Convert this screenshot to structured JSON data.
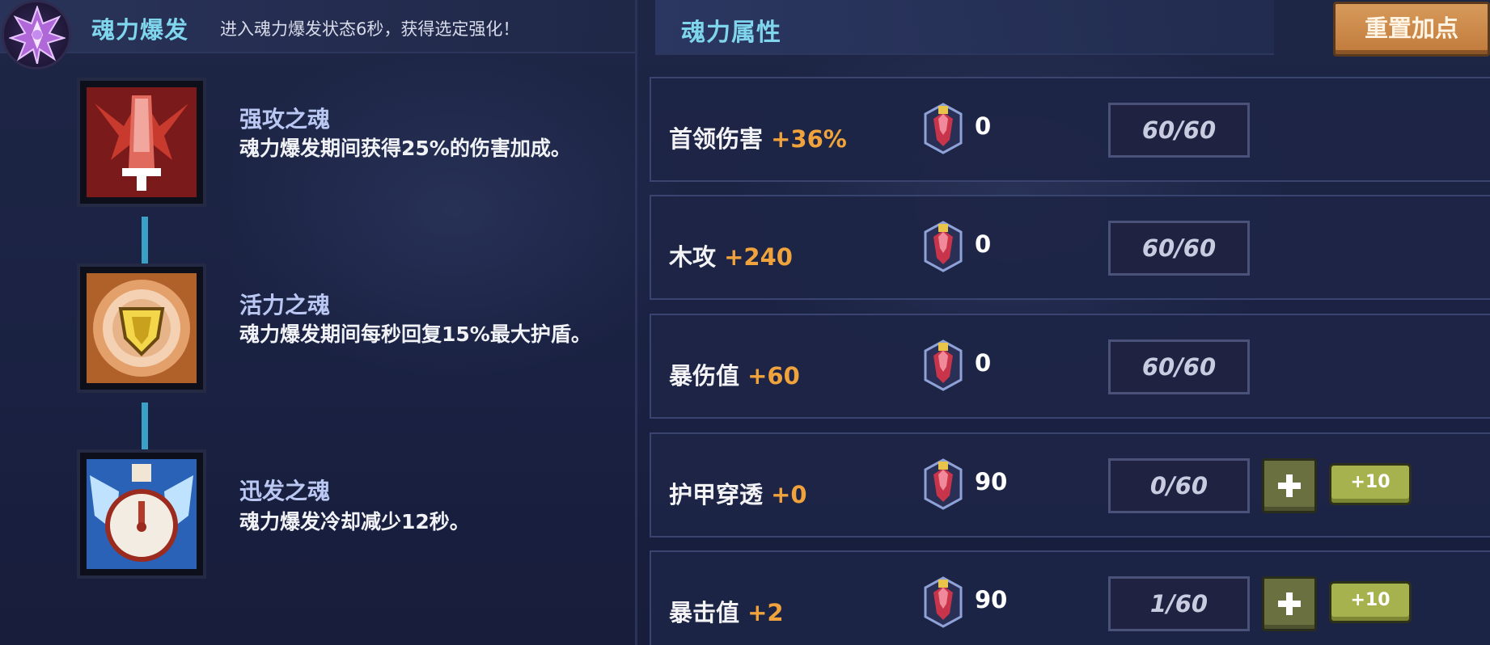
{
  "burst": {
    "title": "魂力爆发",
    "description": "进入魂力爆发状态6秒，获得选定强化！"
  },
  "souls": [
    {
      "name": "强攻之魂",
      "description": "魂力爆发期间获得25%的伤害加成。",
      "icon": "fire-armor-icon"
    },
    {
      "name": "活力之魂",
      "description": "魂力爆发期间每秒回复15%最大护盾。",
      "icon": "golden-shield-icon"
    },
    {
      "name": "迅发之魂",
      "description": "魂力爆发冷却减少12秒。",
      "icon": "winged-clock-icon"
    }
  ],
  "attributes": {
    "title": "魂力属性",
    "reset_label": "重置加点",
    "rows": [
      {
        "name": "首领伤害",
        "bonus": "+36%",
        "cost": "0",
        "progress": "60/60"
      },
      {
        "name": "木攻",
        "bonus": "+240",
        "cost": "0",
        "progress": "60/60"
      },
      {
        "name": "暴伤值",
        "bonus": "+60",
        "cost": "0",
        "progress": "60/60"
      },
      {
        "name": "护甲穿透",
        "bonus": "+0",
        "cost": "90",
        "progress": "0/60",
        "plus10_label": "+10"
      },
      {
        "name": "暴击值",
        "bonus": "+2",
        "cost": "90",
        "progress": "1/60",
        "plus10_label": "+10"
      }
    ]
  },
  "colors": {
    "accent_cyan": "#7fd6ec",
    "bonus_orange": "#f0a23c",
    "reset_orange": "#c98a4a",
    "button_olive": "#a5b24e",
    "panel_navy": "#1d2546"
  }
}
